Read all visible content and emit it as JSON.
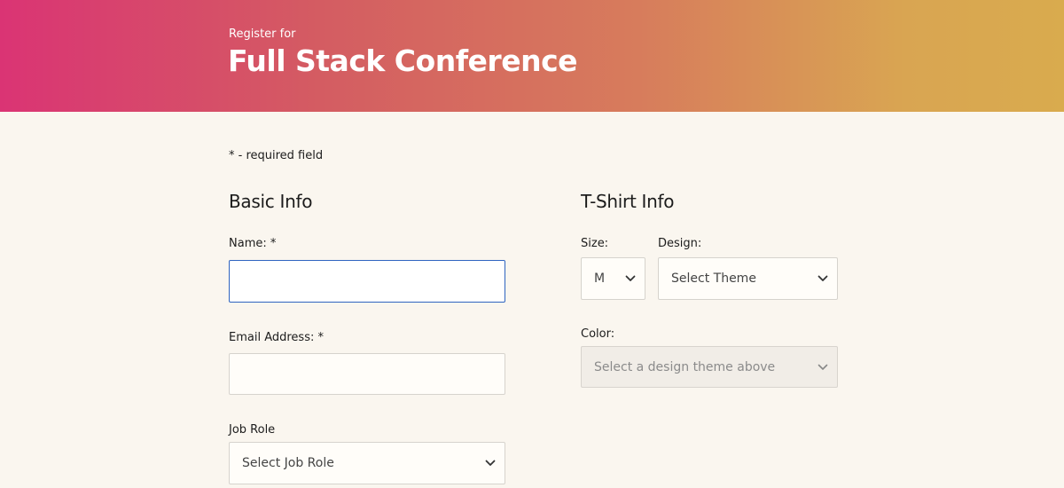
{
  "header": {
    "subtitle": "Register for",
    "title": "Full Stack Conference"
  },
  "required_note": "* - required field",
  "basic_info": {
    "title": "Basic Info",
    "name_label": "Name: *",
    "name_value": "",
    "email_label": "Email Address: *",
    "email_value": "",
    "job_role_label": "Job Role",
    "job_role_selected": "Select Job Role"
  },
  "tshirt_info": {
    "title": "T-Shirt Info",
    "size_label": "Size:",
    "size_selected": "M",
    "design_label": "Design:",
    "design_selected": "Select Theme",
    "color_label": "Color:",
    "color_selected": "Select a design theme above"
  },
  "icons": {
    "select_arrow": "chevron-down-icon"
  },
  "colors": {
    "focus_border": "#2f64c0",
    "page_background": "#faf6ef",
    "gradient_start": "#da3474",
    "gradient_end": "#d9ab4e"
  }
}
